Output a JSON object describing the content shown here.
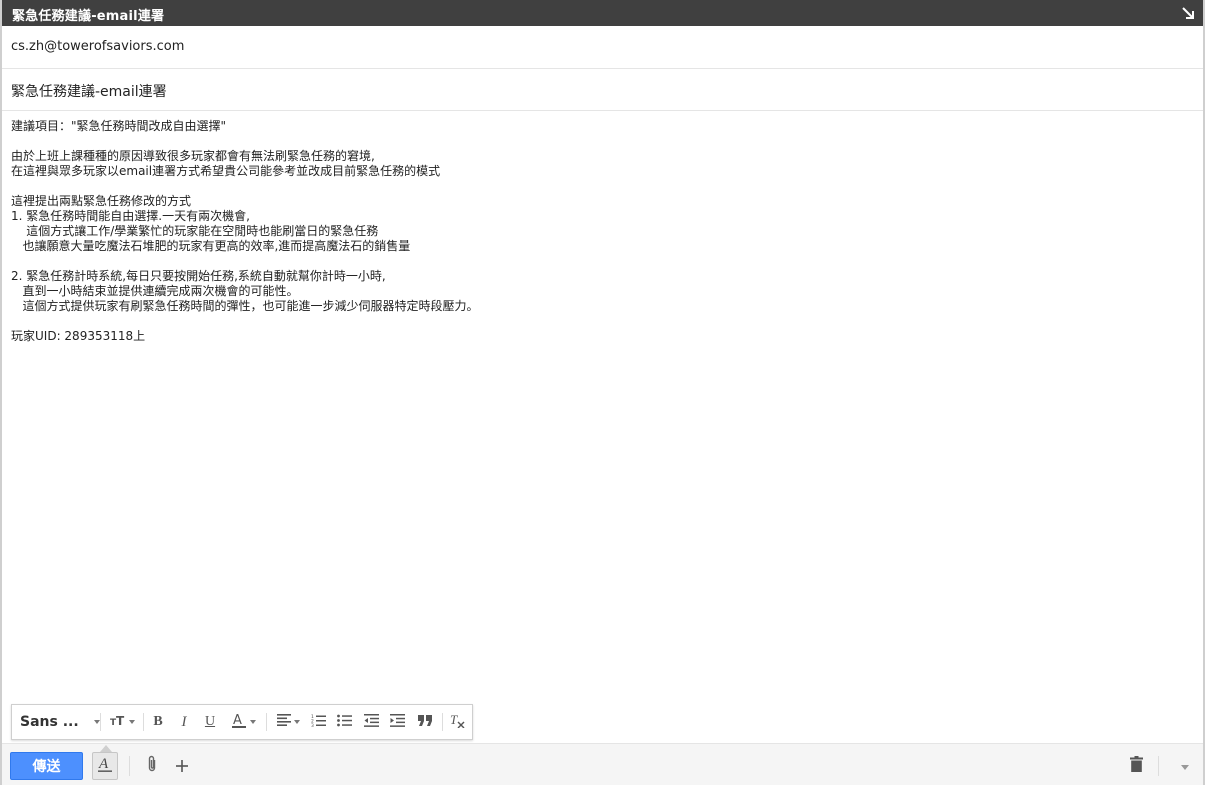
{
  "window": {
    "title": "緊急任務建議-email連署"
  },
  "compose": {
    "to": "cs.zh@towerofsaviors.com",
    "subject": "緊急任務建議-email連署",
    "body_lines": [
      "建議項目：\"緊急任務時間改成自由選擇\"",
      "",
      "由於上班上課種種的原因導致很多玩家都會有無法刷緊急任務的窘境,",
      "在這裡與眾多玩家以email連署方式希望貴公司能參考並改成目前緊急任務的模式",
      "",
      "這裡提出兩點緊急任務修改的方式",
      "1. 緊急任務時間能自由選擇.一天有兩次機會,",
      "    這個方式讓工作/學業繁忙的玩家能在空閒時也能刷當日的緊急任務",
      "   也讓願意大量吃魔法石堆肥的玩家有更高的效率,進而提高魔法石的銷售量",
      "",
      "2. 緊急任務計時系統,每日只要按開始任務,系統自動就幫你計時一小時,",
      "   直到一小時結束並提供連續完成兩次機會的可能性。",
      "   這個方式提供玩家有刷緊急任務時間的彈性，也可能進一步減少伺服器特定時段壓力。",
      "",
      "玩家UID: 289353118上"
    ]
  },
  "format_toolbar": {
    "font_label": "Sans ...",
    "icons": [
      "font-size-icon",
      "bold-icon",
      "italic-icon",
      "underline-icon",
      "text-color-icon",
      "align-icon",
      "numbered-list-icon",
      "bulleted-list-icon",
      "indent-less-icon",
      "indent-more-icon",
      "quote-icon",
      "remove-formatting-icon"
    ]
  },
  "bottom_bar": {
    "send_label": "傳送"
  },
  "colors": {
    "titlebar_bg": "#404040",
    "send_button": "#4d90fe"
  }
}
